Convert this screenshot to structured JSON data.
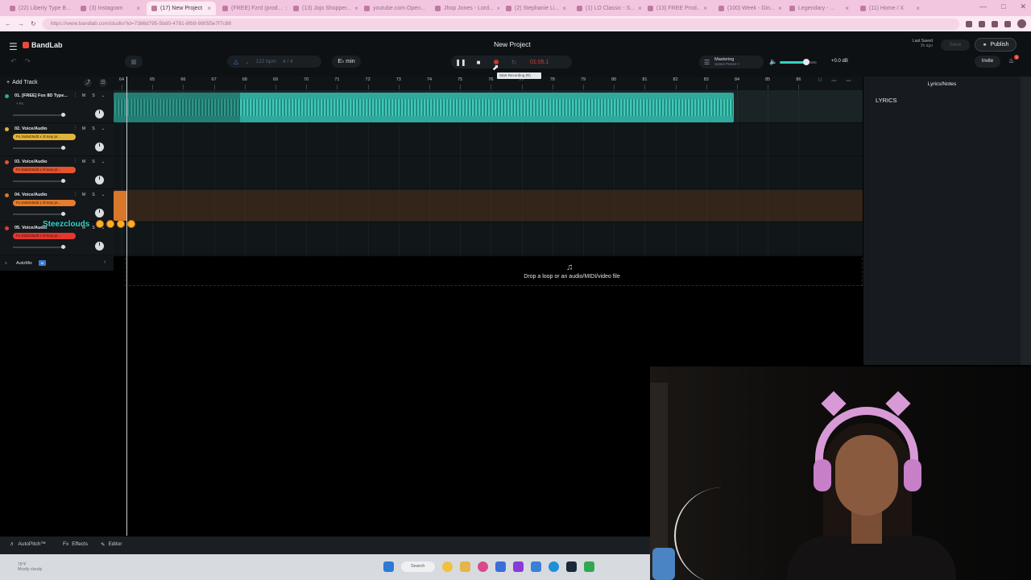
{
  "browser": {
    "tabs": [
      {
        "label": "(22) Liberty Type B...",
        "active": false
      },
      {
        "label": "(3) Instagram",
        "active": false
      },
      {
        "label": "(17) New Project",
        "active": true
      },
      {
        "label": "(FREE) Fzrd (prod...",
        "active": false
      },
      {
        "label": "(13) Jojo Shopper...",
        "active": false
      },
      {
        "label": "youtube.com Open...",
        "active": false
      },
      {
        "label": "Jhop Jones - Lord...",
        "active": false
      },
      {
        "label": "(2) Stephanie Li...",
        "active": false
      },
      {
        "label": "(1) LO Classic - S...",
        "active": false
      },
      {
        "label": "(13) FREE Prod..",
        "active": false
      },
      {
        "label": "(100) Week - Gin...",
        "active": false
      },
      {
        "label": "Legendary - ...",
        "active": false
      },
      {
        "label": "(11) Home / X",
        "active": false
      }
    ],
    "url": "https://www.bandlab.com/studio?id=7386d795-5bd0-4781-8fb9-98055e7f7c88"
  },
  "app": {
    "brand": "BandLab",
    "project_title": "New Project",
    "tempo": "122 bpm",
    "time_signature": "4 / 4",
    "key": "E♭ min",
    "time_readout": "01:05.1",
    "tooltip": "Start Recording (R)",
    "mastering_label": "Mastering",
    "mastering_sub": "Select Preset >",
    "volume_readout": "+0.0 dB",
    "volume_level": 0.72,
    "last_saved_label": "Last Saved",
    "last_saved_time": "3h ago",
    "save_label": "Save",
    "publish_label": "Publish",
    "invite_label": "Invite",
    "notification_count": "1"
  },
  "tracks_header": {
    "add_track": "Add Track"
  },
  "ruler": {
    "bars": [
      "64",
      "65",
      "66",
      "67",
      "68",
      "69",
      "70",
      "71",
      "72",
      "73",
      "74",
      "75",
      "76",
      "77",
      "78",
      "79",
      "80",
      "81",
      "82",
      "83",
      "84",
      "85",
      "86"
    ]
  },
  "tracks": [
    {
      "name": "01. [FREE] Fox 8D Type...",
      "fx": "+ Fx",
      "fx_color": "",
      "color": "#2fa99b"
    },
    {
      "name": "02. Voice/Audio",
      "fx": "Fx 2sdsrt3sd3 x 3l tony pr...",
      "fx_color": "#e0b33a",
      "color": "#e0b33a"
    },
    {
      "name": "03. Voice/Audio",
      "fx": "Fx 2sdsrt3sd3 x 3l tony pr...",
      "fx_color": "#e5532f",
      "color": "#e5532f"
    },
    {
      "name": "04. Voice/Audio",
      "fx": "Fx 2sdsrt3sd3 x 3l tony pr...",
      "fx_color": "#e57c2f",
      "color": "#d9772b"
    },
    {
      "name": "05. Voice/Audio",
      "fx": "Fx 2sdsrt3sd3 x 3l tony pr...",
      "fx_color": "#e5362f",
      "color": "#e5362f"
    }
  ],
  "track_buttons": {
    "mute": "M",
    "solo": "S"
  },
  "overlay": {
    "streamer_name": "Steezclouds"
  },
  "automix": {
    "label": "AutoMix",
    "badge": "AI"
  },
  "drop_zone": {
    "text": "Drop a loop or an audio/MIDI/video file"
  },
  "lyrics": {
    "panel_title": "Lyrics/Notes",
    "heading": "LYRICS"
  },
  "bottom_bar": {
    "autopitch": "AutoPitch™",
    "effects": "Effects",
    "editor": "Editor"
  },
  "taskbar": {
    "weather_temp": "79°F",
    "weather_desc": "Mostly cloudy",
    "search_label": "Search"
  },
  "icons": [
    "menu-icon",
    "search-icon",
    "pause-icon",
    "stop-icon",
    "record-icon",
    "loop-icon",
    "volume-icon",
    "bell-icon",
    "globe-icon",
    "metronome-icon",
    "plus-icon",
    "chevron-right-icon",
    "music-note-icon"
  ]
}
